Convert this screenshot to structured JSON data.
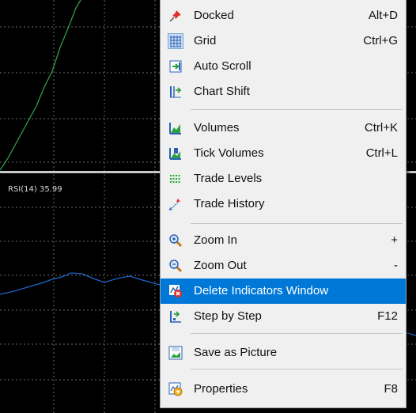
{
  "chart": {
    "rsi_label": "RSI(14) 35.99"
  },
  "menu": {
    "items": [
      {
        "label": "Docked",
        "shortcut": "Alt+D",
        "icon": "pin-icon"
      },
      {
        "label": "Grid",
        "shortcut": "Ctrl+G",
        "icon": "grid-icon"
      },
      {
        "label": "Auto Scroll",
        "shortcut": "",
        "icon": "auto-scroll-icon"
      },
      {
        "label": "Chart Shift",
        "shortcut": "",
        "icon": "chart-shift-icon"
      },
      {
        "label": "Volumes",
        "shortcut": "Ctrl+K",
        "icon": "volumes-icon"
      },
      {
        "label": "Tick Volumes",
        "shortcut": "Ctrl+L",
        "icon": "tick-volumes-icon"
      },
      {
        "label": "Trade Levels",
        "shortcut": "",
        "icon": "trade-levels-icon"
      },
      {
        "label": "Trade History",
        "shortcut": "",
        "icon": "trade-history-icon"
      },
      {
        "label": "Zoom In",
        "shortcut": "+",
        "icon": "zoom-in-icon"
      },
      {
        "label": "Zoom Out",
        "shortcut": "-",
        "icon": "zoom-out-icon"
      },
      {
        "label": "Delete Indicators Window",
        "shortcut": "",
        "icon": "delete-indicator-icon"
      },
      {
        "label": "Step by Step",
        "shortcut": "F12",
        "icon": "step-icon"
      },
      {
        "label": "Save as Picture",
        "shortcut": "",
        "icon": "save-picture-icon"
      },
      {
        "label": "Properties",
        "shortcut": "F8",
        "icon": "properties-icon"
      }
    ]
  },
  "colors": {
    "highlight": "#0078d7",
    "menu_bg": "#f0f0f0",
    "chart_bg": "#000000",
    "price_line": "#2ea043",
    "rsi_line": "#1e64c8"
  }
}
